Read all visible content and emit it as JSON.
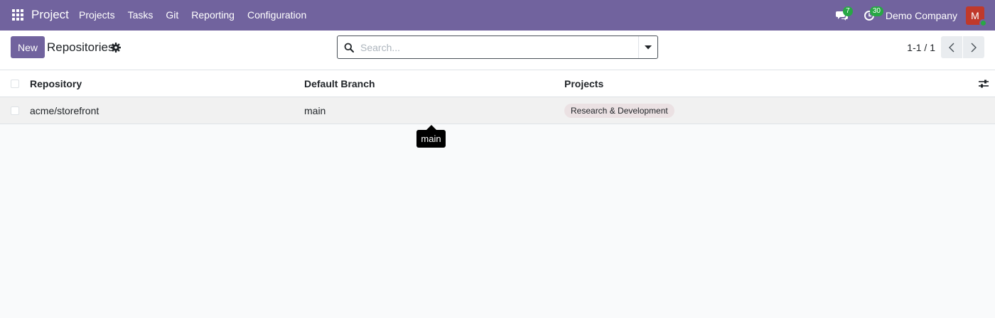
{
  "navbar": {
    "brand": "Project",
    "menu": [
      {
        "label": "Projects"
      },
      {
        "label": "Tasks"
      },
      {
        "label": "Git"
      },
      {
        "label": "Reporting"
      },
      {
        "label": "Configuration"
      }
    ],
    "messages_count": "7",
    "activities_count": "30",
    "company": "Demo Company",
    "avatar_initial": "M"
  },
  "control_panel": {
    "new_label": "New",
    "title": "Repositories",
    "search_placeholder": "Search...",
    "pager_value": "1-1 / 1"
  },
  "table": {
    "headers": {
      "repository": "Repository",
      "default_branch": "Default Branch",
      "projects": "Projects"
    },
    "rows": [
      {
        "repository": "acme/storefront",
        "default_branch": "main",
        "project_tag": "Research & Development"
      }
    ]
  },
  "tooltip": {
    "text": "main"
  },
  "colors": {
    "brand": "#71639e",
    "badge": "#28a745",
    "avatar": "#c0392b"
  }
}
